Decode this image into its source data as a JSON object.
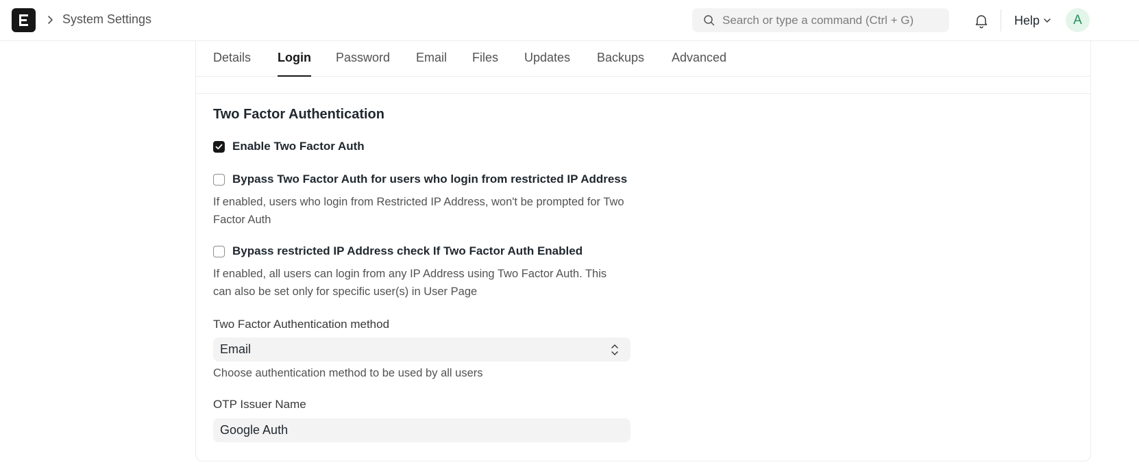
{
  "navbar": {
    "breadcrumb_title": "System Settings",
    "search_placeholder": "Search or type a command (Ctrl + G)",
    "help_label": "Help",
    "avatar_initial": "A"
  },
  "tabs": [
    {
      "label": "Details",
      "active": false
    },
    {
      "label": "Login",
      "active": true
    },
    {
      "label": "Password",
      "active": false
    },
    {
      "label": "Email",
      "active": false
    },
    {
      "label": "Files",
      "active": false
    },
    {
      "label": "Updates",
      "active": false
    },
    {
      "label": "Backups",
      "active": false
    },
    {
      "label": "Advanced",
      "active": false
    }
  ],
  "section": {
    "title": "Two Factor Authentication",
    "enable_2fa": {
      "label": "Enable Two Factor Auth",
      "checked": true
    },
    "bypass_restricted": {
      "label": "Bypass Two Factor Auth for users who login from restricted IP Address",
      "checked": false,
      "description": "If enabled, users who login from Restricted IP Address, won't be prompted for Two Factor Auth"
    },
    "bypass_ip_check": {
      "label": "Bypass restricted IP Address check If Two Factor Auth Enabled",
      "checked": false,
      "description": "If enabled, all users can login from any IP Address using Two Factor Auth. This can also be set only for specific user(s) in User Page"
    },
    "method": {
      "label": "Two Factor Authentication method",
      "value": "Email",
      "description": "Choose authentication method to be used by all users"
    },
    "otp_issuer": {
      "label": "OTP Issuer Name",
      "value": "Google Auth"
    }
  },
  "colors": {
    "accent": "#171717",
    "avatar_bg": "#e4f5e9",
    "avatar_text": "#278f5e"
  }
}
